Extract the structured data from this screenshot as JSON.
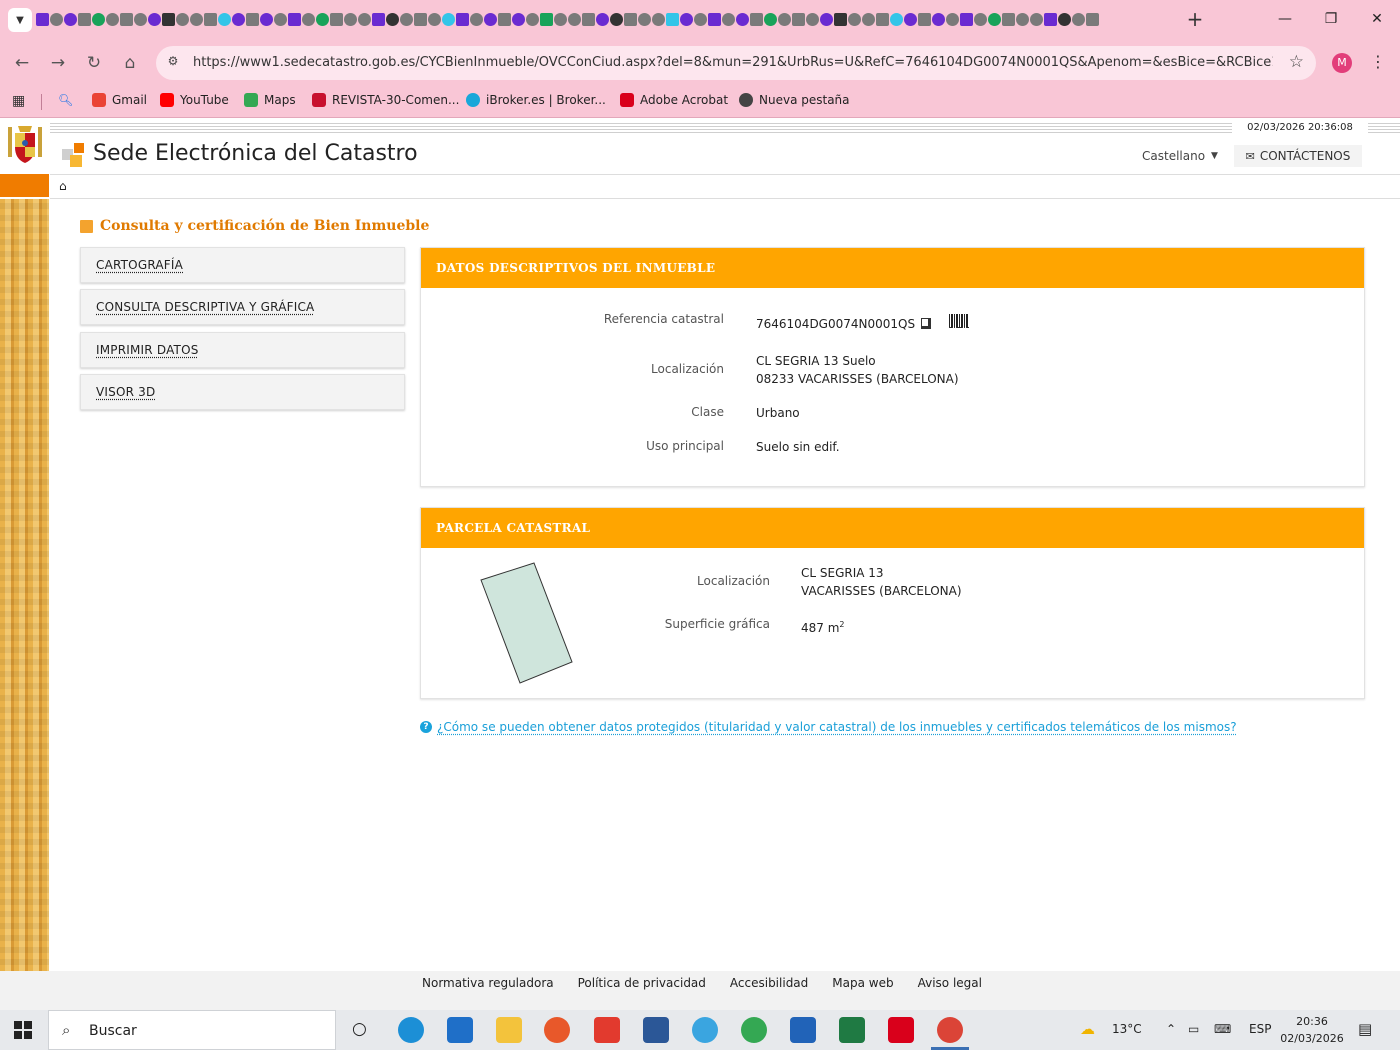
{
  "browser": {
    "url": "https://www1.sedecatastro.gob.es/CYCBienInmueble/OVCConCiud.aspx?del=8&mun=291&UrbRus=U&RefC=7646104DG0074N0001QS&Apenom=&esBice=&RCBice1=&R...",
    "profile_initial": "M",
    "bookmarks": [
      {
        "label": "Gmail",
        "color": "#ea4335"
      },
      {
        "label": "YouTube",
        "color": "#ff0000"
      },
      {
        "label": "Maps",
        "color": "#34a853"
      },
      {
        "label": "REVISTA-30-Comen...",
        "color": "#c8102e"
      },
      {
        "label": "iBroker.es | Broker...",
        "color": "#19a7d9"
      },
      {
        "label": "Adobe Acrobat",
        "color": "#d9001b"
      },
      {
        "label": "Nueva pestaña",
        "color": "#444444"
      }
    ]
  },
  "header": {
    "datetime": "02/03/2026  20:36:08",
    "site_title": "Sede Electrónica del Catastro",
    "language": "Castellano",
    "contact_label": "CONTÁCTENOS"
  },
  "main": {
    "section_title": "Consulta y certificación de Bien Inmueble",
    "menu": [
      {
        "label": "CARTOGRAFÍA"
      },
      {
        "label": "CONSULTA DESCRIPTIVA Y GRÁFICA"
      },
      {
        "label": "IMPRIMIR DATOS"
      },
      {
        "label": "VISOR 3D"
      }
    ],
    "descriptive": {
      "title": "DATOS DESCRIPTIVOS DEL INMUEBLE",
      "ref_label": "Referencia catastral",
      "ref_value": "7646104DG0074N0001QS",
      "loc_label": "Localización",
      "loc_line1": "CL SEGRIA 13 Suelo",
      "loc_line2": "08233 VACARISSES (BARCELONA)",
      "class_label": "Clase",
      "class_value": "Urbano",
      "use_label": "Uso principal",
      "use_value": "Suelo sin edif."
    },
    "parcel": {
      "title": "PARCELA CATASTRAL",
      "loc_label": "Localización",
      "loc_line1": "CL SEGRIA 13",
      "loc_line2": "VACARISSES (BARCELONA)",
      "area_label": "Superficie gráfica",
      "area_value": "487 m",
      "area_sup": "2"
    },
    "help_link": "¿Cómo se pueden obtener datos protegidos (titularidad y valor catastral) de los inmuebles y certificados telemáticos de los mismos?"
  },
  "footer": {
    "links": [
      {
        "label": "Normativa reguladora"
      },
      {
        "label": "Política de privacidad"
      },
      {
        "label": "Accesibilidad"
      },
      {
        "label": "Mapa web"
      },
      {
        "label": "Aviso legal"
      }
    ]
  },
  "taskbar": {
    "search_label": "Buscar",
    "temperature": "13°C",
    "language": "ESP",
    "time": "20:36",
    "date": "02/03/2026"
  },
  "colors": {
    "accent_orange": "#ffa500",
    "title_orange": "#e07a00",
    "link_blue": "#1a9fd8",
    "chrome_pink": "#f9c6d6"
  }
}
